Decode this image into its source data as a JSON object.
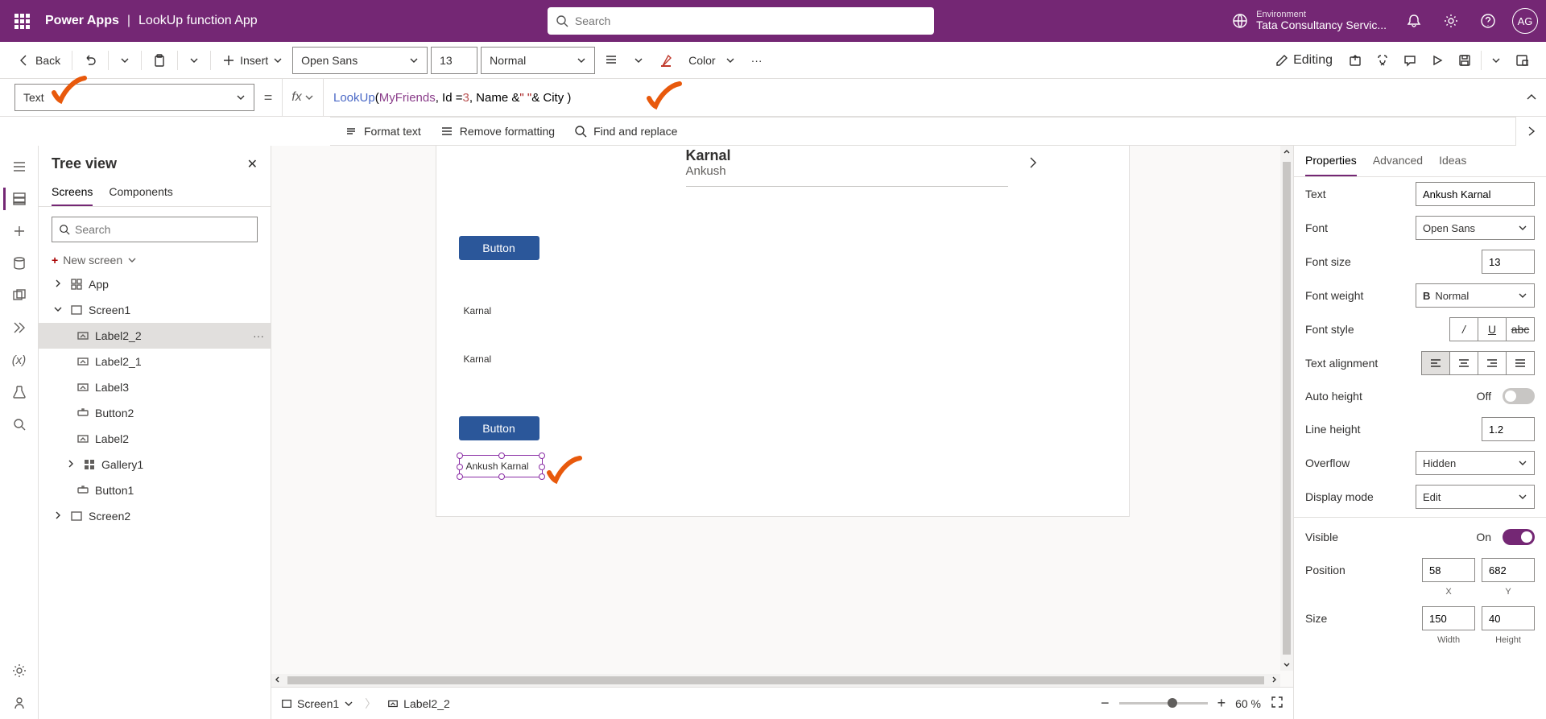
{
  "header": {
    "brand": "Power Apps",
    "appName": "LookUp function App",
    "searchPlaceholder": "Search",
    "envLabel": "Environment",
    "envName": "Tata Consultancy Servic...",
    "avatar": "AG"
  },
  "toolbar": {
    "back": "Back",
    "insert": "Insert",
    "font": "Open Sans",
    "fontSize": "13",
    "weight": "Normal",
    "color": "Color",
    "editing": "Editing"
  },
  "fx": {
    "property": "Text",
    "lookup": "LookUp",
    "ds": "MyFriends",
    "part1": ", Id =",
    "num": "3",
    "part2": ", Name & ",
    "q1": "\" \"",
    "part3": " & City )",
    "formatText": "Format text",
    "removeFmt": "Remove formatting",
    "findReplace": "Find and replace"
  },
  "tree": {
    "title": "Tree view",
    "screens": "Screens",
    "components": "Components",
    "searchPlaceholder": "Search",
    "newScreen": "New screen",
    "app": "App",
    "screen1": "Screen1",
    "items": [
      {
        "name": "Label2_2",
        "sel": true
      },
      {
        "name": "Label2_1"
      },
      {
        "name": "Label3"
      },
      {
        "name": "Button2"
      },
      {
        "name": "Label2"
      },
      {
        "name": "Gallery1"
      },
      {
        "name": "Button1"
      }
    ],
    "screen2": "Screen2"
  },
  "canvas": {
    "galTitle": "Karnal",
    "galSub": "Ankush",
    "btn1": "Button",
    "btn2": "Button",
    "label1": "Karnal",
    "label2": "Karnal",
    "selLabel": "Ankush Karnal"
  },
  "status": {
    "screen": "Screen1",
    "item": "Label2_2",
    "zoom": "60",
    "pct": "%"
  },
  "props": {
    "tabProps": "Properties",
    "tabAdv": "Advanced",
    "tabIdeas": "Ideas",
    "textLbl": "Text",
    "textVal": "Ankush Karnal",
    "fontLbl": "Font",
    "fontVal": "Open Sans",
    "fontSizeLbl": "Font size",
    "fontSizeVal": "13",
    "fontWeightLbl": "Font weight",
    "fontWeightVal": "Normal",
    "fontStyleLbl": "Font style",
    "alignLbl": "Text alignment",
    "autoHLbl": "Auto height",
    "autoHVal": "Off",
    "lineHLbl": "Line height",
    "lineHVal": "1.2",
    "overflowLbl": "Overflow",
    "overflowVal": "Hidden",
    "dispModeLbl": "Display mode",
    "dispModeVal": "Edit",
    "visibleLbl": "Visible",
    "visibleVal": "On",
    "posLbl": "Position",
    "posX": "58",
    "posY": "682",
    "xLbl": "X",
    "yLbl": "Y",
    "sizeLbl": "Size",
    "sizeW": "150",
    "sizeH": "40",
    "wLbl": "Width",
    "hLbl": "Height",
    "bold": "B"
  }
}
